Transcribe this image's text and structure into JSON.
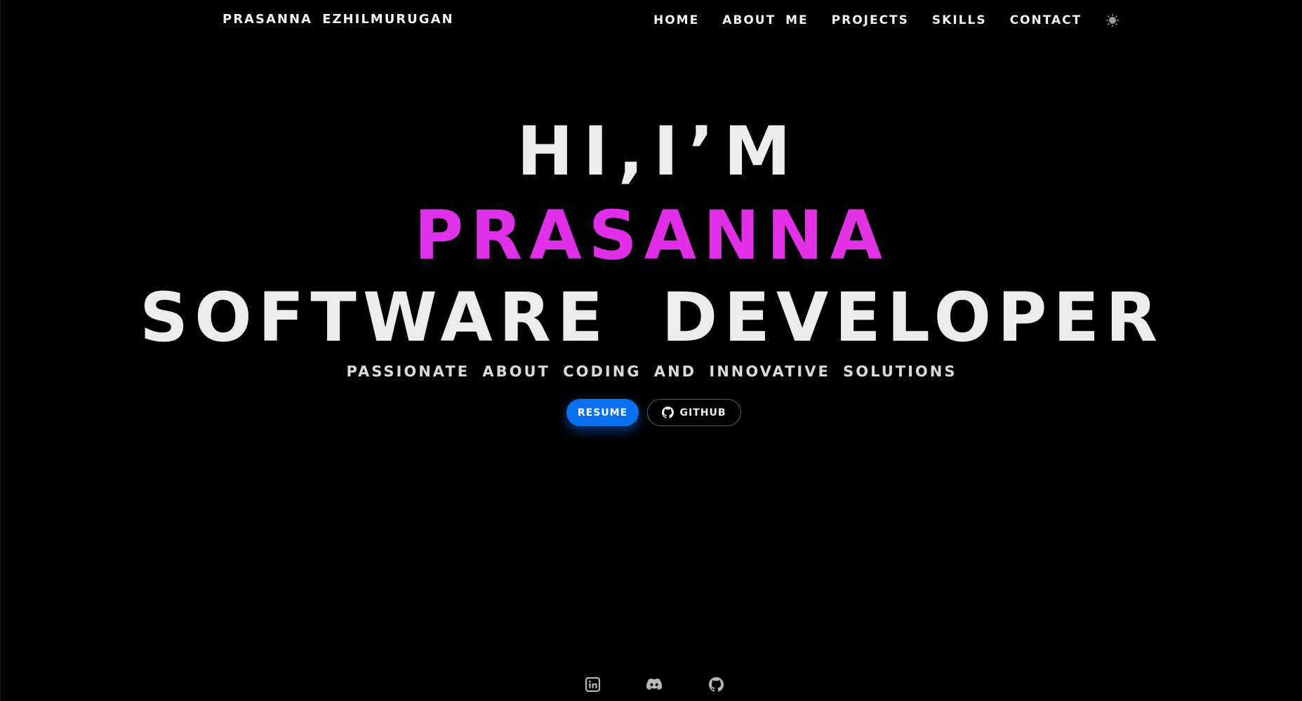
{
  "header": {
    "brand": "PRASANNA EZHILMURUGAN",
    "nav": {
      "home": "HOME",
      "about": "ABOUT ME",
      "projects": "PROJECTS",
      "skills": "SKILLS",
      "contact": "CONTACT"
    },
    "theme_icon": "sun-icon"
  },
  "hero": {
    "greeting": "HI,I’M",
    "name": "PRASANNA",
    "role": "SOFTWARE DEVELOPER",
    "tagline": "PASSIONATE ABOUT CODING AND INNOVATIVE SOLUTIONS",
    "buttons": {
      "resume": "RESUME",
      "github": "GITHUB"
    }
  },
  "footer": {
    "socials": [
      "linkedin-icon",
      "discord-icon",
      "github-icon"
    ]
  },
  "colors": {
    "background": "#000000",
    "text": "#ececef",
    "accent_name": "#e12ee3",
    "resume_button": "#0a70f2"
  }
}
